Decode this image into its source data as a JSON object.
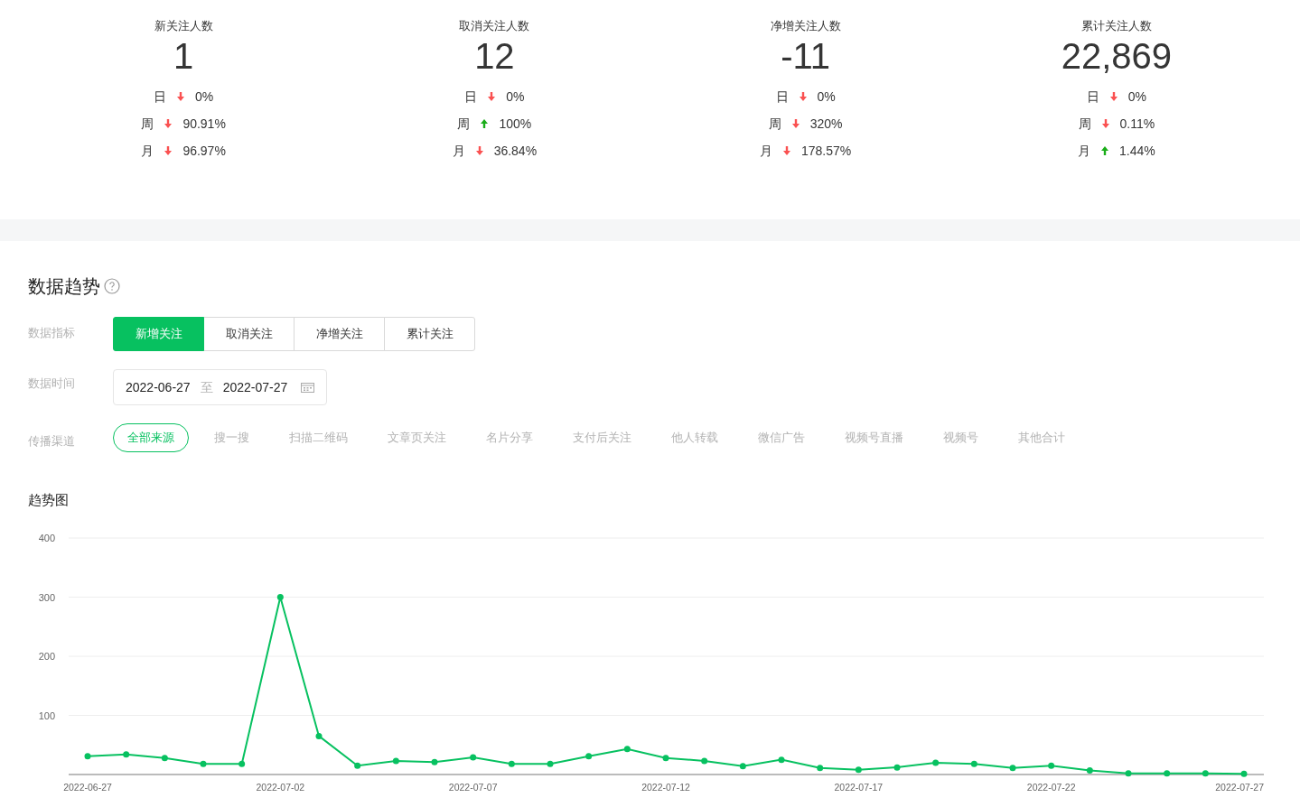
{
  "stats": [
    {
      "label": "新关注人数",
      "value": "1",
      "changes": [
        {
          "period": "日",
          "kind": "down",
          "value": "0%"
        },
        {
          "period": "周",
          "kind": "down",
          "value": "90.91%"
        },
        {
          "period": "月",
          "kind": "down",
          "value": "96.97%"
        }
      ]
    },
    {
      "label": "取消关注人数",
      "value": "12",
      "changes": [
        {
          "period": "日",
          "kind": "down",
          "value": "0%"
        },
        {
          "period": "周",
          "kind": "up",
          "value": "100%"
        },
        {
          "period": "月",
          "kind": "down",
          "value": "36.84%"
        }
      ]
    },
    {
      "label": "净增关注人数",
      "value": "-11",
      "changes": [
        {
          "period": "日",
          "kind": "down",
          "value": "0%"
        },
        {
          "period": "周",
          "kind": "down",
          "value": "320%"
        },
        {
          "period": "月",
          "kind": "down",
          "value": "178.57%"
        }
      ]
    },
    {
      "label": "累计关注人数",
      "value": "22,869",
      "changes": [
        {
          "period": "日",
          "kind": "down",
          "value": "0%"
        },
        {
          "period": "周",
          "kind": "down",
          "value": "0.11%"
        },
        {
          "period": "月",
          "kind": "up",
          "value": "1.44%"
        }
      ]
    }
  ],
  "trend": {
    "title": "数据趋势",
    "metric": {
      "label": "数据指标",
      "options": [
        {
          "label": "新增关注",
          "selected": true
        },
        {
          "label": "取消关注",
          "selected": false
        },
        {
          "label": "净增关注",
          "selected": false
        },
        {
          "label": "累计关注",
          "selected": false
        }
      ]
    },
    "time": {
      "label": "数据时间",
      "start": "2022-06-27",
      "separator": "至",
      "end": "2022-07-27"
    },
    "channel": {
      "label": "传播渠道",
      "options": [
        {
          "label": "全部来源",
          "selected": true
        },
        {
          "label": "搜一搜",
          "selected": false
        },
        {
          "label": "扫描二维码",
          "selected": false
        },
        {
          "label": "文章页关注",
          "selected": false
        },
        {
          "label": "名片分享",
          "selected": false
        },
        {
          "label": "支付后关注",
          "selected": false
        },
        {
          "label": "他人转载",
          "selected": false
        },
        {
          "label": "微信广告",
          "selected": false
        },
        {
          "label": "视频号直播",
          "selected": false
        },
        {
          "label": "视频号",
          "selected": false
        },
        {
          "label": "其他合计",
          "selected": false
        }
      ]
    },
    "chart_title": "趋势图",
    "chart_data": {
      "type": "line",
      "categories": [
        "2022-06-27",
        null,
        null,
        null,
        null,
        "2022-07-02",
        null,
        null,
        null,
        null,
        "2022-07-07",
        null,
        null,
        null,
        null,
        "2022-07-12",
        null,
        null,
        null,
        null,
        "2022-07-17",
        null,
        null,
        null,
        null,
        "2022-07-22",
        null,
        null,
        null,
        null,
        "2022-07-27"
      ],
      "series": [
        {
          "color": "#07c160",
          "values": [
            31,
            34,
            28,
            18,
            18,
            300,
            65,
            15,
            23,
            21,
            29,
            18,
            18,
            31,
            43,
            28,
            23,
            14,
            25,
            11,
            8,
            12,
            20,
            18,
            11,
            15,
            7,
            2,
            2,
            2,
            1
          ]
        }
      ],
      "ylim": [
        0,
        400
      ],
      "yticks": [
        100,
        200,
        300,
        400
      ],
      "grid": true,
      "marker": true
    }
  }
}
